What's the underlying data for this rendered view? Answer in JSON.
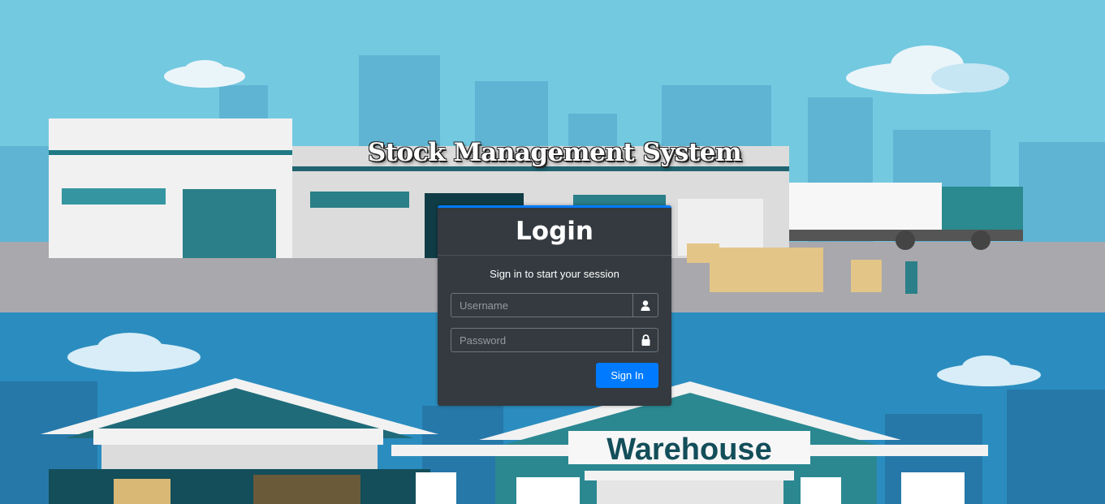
{
  "app": {
    "title": "Stock Management System"
  },
  "background": {
    "warehouse_sign": "Warehouse"
  },
  "login": {
    "title": "Login",
    "message": "Sign in to start your session",
    "username": {
      "placeholder": "Username",
      "value": "",
      "icon": "user-icon"
    },
    "password": {
      "placeholder": "Password",
      "value": "",
      "icon": "lock-icon"
    },
    "submit_label": "Sign In"
  },
  "colors": {
    "accent": "#007bff",
    "card_bg": "#343a40",
    "sky": "#73c9e0",
    "lower_sky": "#2b8dbf"
  }
}
